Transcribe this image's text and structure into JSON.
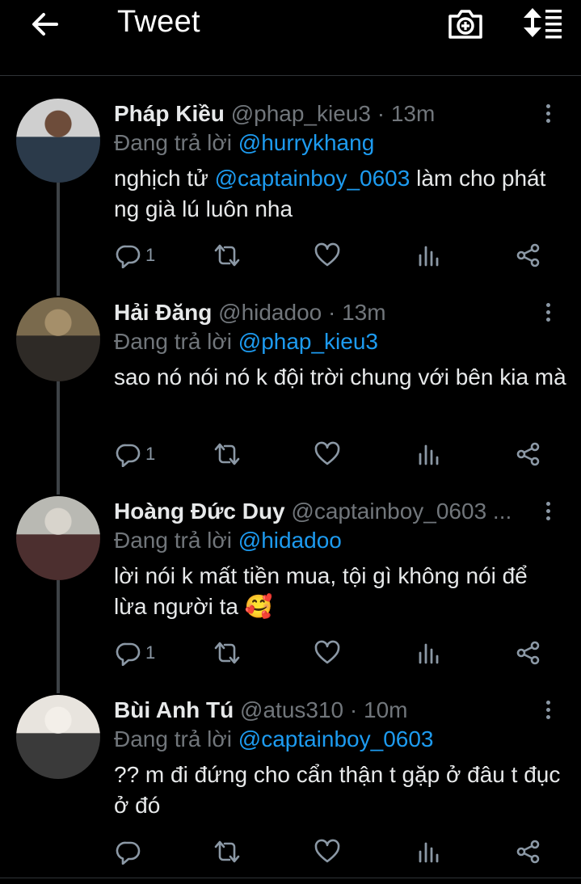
{
  "header": {
    "title": "Tweet",
    "back_icon": "arrow-left-icon",
    "camera_icon": "camera-plus-icon",
    "sort_icon": "sort-icon"
  },
  "tweets": [
    {
      "name": "Pháp Kiều",
      "handle": "@phap_kieu3",
      "sep": "·",
      "time": "13m",
      "reply_prefix": "Đang trả lời",
      "reply_to": "@hurrykhang",
      "body_pre": "nghịch tử ",
      "body_mention": "@captainboy_0603",
      "body_post": " làm cho phát ng già lú luôn nha",
      "reply_count": "1",
      "avatar_colors": [
        "#cfcfcf",
        "#2b3a4a",
        "#6d4c3a"
      ]
    },
    {
      "name": "Hải Đăng",
      "handle": "@hidadoo",
      "sep": "·",
      "time": "13m",
      "reply_prefix": "Đang trả lời",
      "reply_to": "@phap_kieu3",
      "body_pre": "sao nó nói nó k đội trời chung với bên kia mà",
      "body_mention": "",
      "body_post": "",
      "reply_count": "1",
      "avatar_colors": [
        "#7a6a4d",
        "#2e2a26",
        "#a58f6a"
      ]
    },
    {
      "name": "Hoàng Đức Duy",
      "handle": "@captainboy_0603 ...",
      "sep": "",
      "time": "",
      "reply_prefix": "Đang trả lời",
      "reply_to": "@hidadoo",
      "body_pre": "lời nói k mất tiền mua, tội gì không nói để lừa người ta 🥰",
      "body_mention": "",
      "body_post": "",
      "reply_count": "1",
      "avatar_colors": [
        "#b9b9b3",
        "#4c2f2f",
        "#d8d4cc"
      ]
    },
    {
      "name": "Bùi Anh Tú",
      "handle": "@atus310",
      "sep": "·",
      "time": "10m",
      "reply_prefix": "Đang trả lời",
      "reply_to": "@captainboy_0603",
      "body_pre": "?? m đi đứng cho cẩn thận t gặp ở đâu t đục ở đó",
      "body_mention": "",
      "body_post": "",
      "reply_count": "",
      "avatar_colors": [
        "#e8e4de",
        "#3a3a3a",
        "#f3efe9"
      ]
    }
  ],
  "action_icons": [
    "reply-icon",
    "retweet-icon",
    "like-icon",
    "views-icon",
    "share-icon"
  ],
  "colors": {
    "background": "#000000",
    "accent": "#1d9bf0",
    "muted": "#71767b",
    "text": "#e7e9ea"
  }
}
